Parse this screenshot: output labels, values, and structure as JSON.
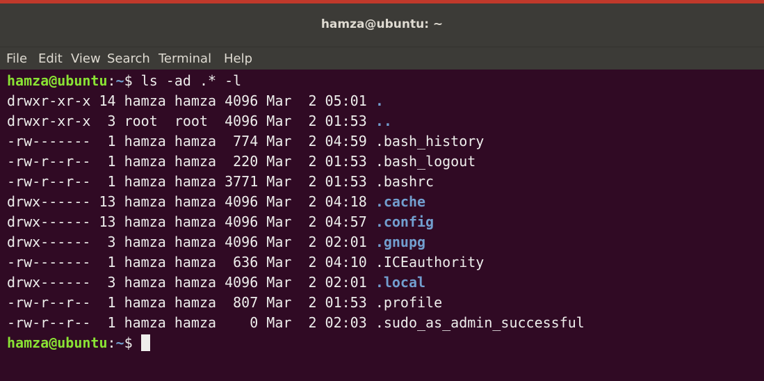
{
  "window": {
    "title": "hamza@ubuntu: ~"
  },
  "menu": [
    {
      "label": "File"
    },
    {
      "label": "Edit"
    },
    {
      "label": "View"
    },
    {
      "label": "Search"
    },
    {
      "label": "Terminal"
    },
    {
      "label": "Help"
    }
  ],
  "prompt": {
    "user_host": "hamza@ubuntu",
    "path": "~",
    "symbol": "$",
    "command": " ls -ad .* -l"
  },
  "listing": [
    {
      "meta": "drwxr-xr-x 14 hamza hamza 4096 Mar  2 05:01 ",
      "name": ".",
      "type": "dir"
    },
    {
      "meta": "drwxr-xr-x  3 root  root  4096 Mar  2 01:53 ",
      "name": "..",
      "type": "dir"
    },
    {
      "meta": "-rw-------  1 hamza hamza  774 Mar  2 04:59 ",
      "name": ".bash_history",
      "type": "file"
    },
    {
      "meta": "-rw-r--r--  1 hamza hamza  220 Mar  2 01:53 ",
      "name": ".bash_logout",
      "type": "file"
    },
    {
      "meta": "-rw-r--r--  1 hamza hamza 3771 Mar  2 01:53 ",
      "name": ".bashrc",
      "type": "file"
    },
    {
      "meta": "drwx------ 13 hamza hamza 4096 Mar  2 04:18 ",
      "name": ".cache",
      "type": "dir"
    },
    {
      "meta": "drwx------ 13 hamza hamza 4096 Mar  2 04:57 ",
      "name": ".config",
      "type": "dir"
    },
    {
      "meta": "drwx------  3 hamza hamza 4096 Mar  2 02:01 ",
      "name": ".gnupg",
      "type": "dir"
    },
    {
      "meta": "-rw-------  1 hamza hamza  636 Mar  2 04:10 ",
      "name": ".ICEauthority",
      "type": "file"
    },
    {
      "meta": "drwx------  3 hamza hamza 4096 Mar  2 02:01 ",
      "name": ".local",
      "type": "dir"
    },
    {
      "meta": "-rw-r--r--  1 hamza hamza  807 Mar  2 01:53 ",
      "name": ".profile",
      "type": "file"
    },
    {
      "meta": "-rw-r--r--  1 hamza hamza    0 Mar  2 02:03 ",
      "name": ".sudo_as_admin_successful",
      "type": "file"
    }
  ],
  "colors": {
    "background": "#300a24",
    "text": "#eeeeec",
    "prompt_user": "#8ae234",
    "prompt_path": "#729fcf",
    "directory": "#729fcf",
    "title_bar": "#3c3b37"
  }
}
